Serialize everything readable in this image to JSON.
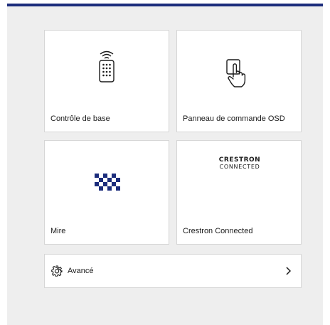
{
  "tiles": [
    {
      "label": "Contrôle de base",
      "icon": "remote-control-icon"
    },
    {
      "label": "Panneau de commande OSD",
      "icon": "touch-panel-icon"
    },
    {
      "label": "Mire",
      "icon": "test-pattern-icon"
    },
    {
      "label": "Crestron Connected",
      "icon": "crestron-logo"
    }
  ],
  "crestron_logo": {
    "line1": "CRESTRON",
    "line2": "CONNECTED"
  },
  "advanced": {
    "label": "Avancé",
    "icon": "gear-icon"
  },
  "colors": {
    "accent_bar": "#1c2d7c",
    "background": "#eeeeee",
    "tile": "#ffffff"
  }
}
